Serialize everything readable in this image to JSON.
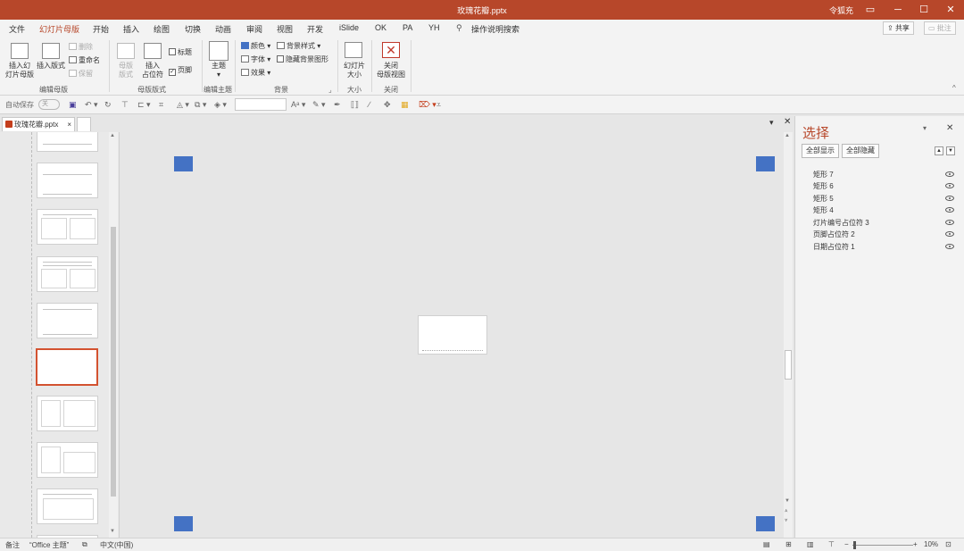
{
  "window": {
    "title": "玫瑰花瓣.pptx",
    "user": "令狐充"
  },
  "menu": {
    "tabs": [
      "文件",
      "幻灯片母版",
      "开始",
      "插入",
      "绘图",
      "切换",
      "动画",
      "审阅",
      "视图",
      "开发",
      "iSlide",
      "OK",
      "PA",
      "YH"
    ],
    "active": "幻灯片母版",
    "search": "操作说明搜索",
    "share": "共享",
    "comment": "批注"
  },
  "ribbon": {
    "insert_master_1": "插入幻",
    "insert_master_2": "灯片母版",
    "insert_layout": "插入版式",
    "delete": "删除",
    "rename": "重命名",
    "preserve": "保留",
    "group_edit_master": "编辑母版",
    "master_layout_1": "母版",
    "master_layout_2": "版式",
    "insert_placeholder_1": "插入",
    "insert_placeholder_2": "占位符",
    "chk_title": "标题",
    "chk_footer": "页脚",
    "group_master_layout": "母版版式",
    "theme": "主题",
    "group_edit_theme": "编辑主题",
    "colors": "颜色",
    "fonts": "字体",
    "effects": "效果",
    "bg_styles": "背景样式",
    "hide_bg": "隐藏背景图形",
    "group_background": "背景",
    "slide_size_1": "幻灯片",
    "slide_size_2": "大小",
    "group_size": "大小",
    "close_view_1": "关闭",
    "close_view_2": "母版视图",
    "group_close": "关闭"
  },
  "qat": {
    "autosave": "自动保存",
    "autosave_state": "关"
  },
  "document_tab": "玫瑰花瓣.pptx",
  "selection_pane": {
    "title": "选择",
    "show_all": "全部显示",
    "hide_all": "全部隐藏",
    "items": [
      "矩形 7",
      "矩形 6",
      "矩形 5",
      "矩形 4",
      "灯片编号占位符 3",
      "页脚占位符 2",
      "日期占位符 1"
    ]
  },
  "status": {
    "notes": "备注",
    "theme": "“Office 主题”",
    "language": "中文(中国)",
    "zoom": "10%"
  },
  "colors": {
    "accent": "#b7472a",
    "shape_fill": "#4472c4",
    "selected_thumb": "#d35230"
  }
}
